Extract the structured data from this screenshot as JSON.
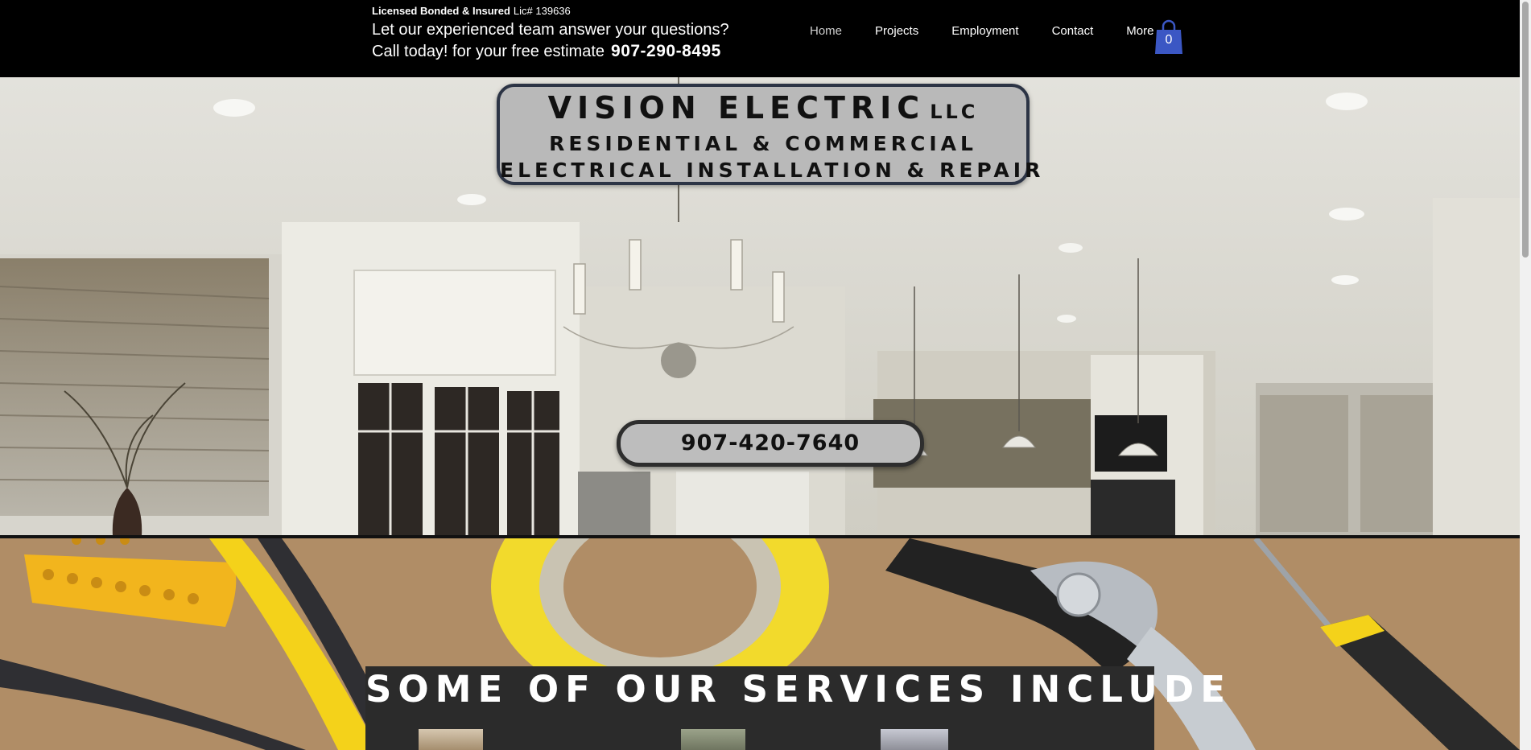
{
  "header": {
    "license_bold": "Licensed Bonded & Insured",
    "license_label": "Lic# 139636",
    "tagline_question": "Let our experienced team answer your questions?",
    "tagline_call": "Call today! for your free estimate",
    "tagline_phone": "907-290-8495"
  },
  "nav": {
    "items": [
      "Home",
      "Projects",
      "Employment",
      "Contact",
      "More"
    ],
    "active": "Home"
  },
  "cart": {
    "count": "0",
    "icon": "shopping-bag-icon",
    "color": "#3b57c4"
  },
  "hero": {
    "brand_name": "VISION ELECTRIC",
    "brand_suffix": "LLC",
    "line1": "RESIDENTIAL & COMMERCIAL",
    "line2": "ELECTRICAL INSTALLATION & REPAIR",
    "phone": "907-420-7640"
  },
  "services": {
    "title": "SOME OF OUR SERVICES INCLUDE"
  },
  "colors": {
    "header_bg": "#000000",
    "brand_box_bg": "#b9b9b9",
    "brand_box_border": "#2c3445",
    "services_panel_bg": "#2b2b2b"
  }
}
